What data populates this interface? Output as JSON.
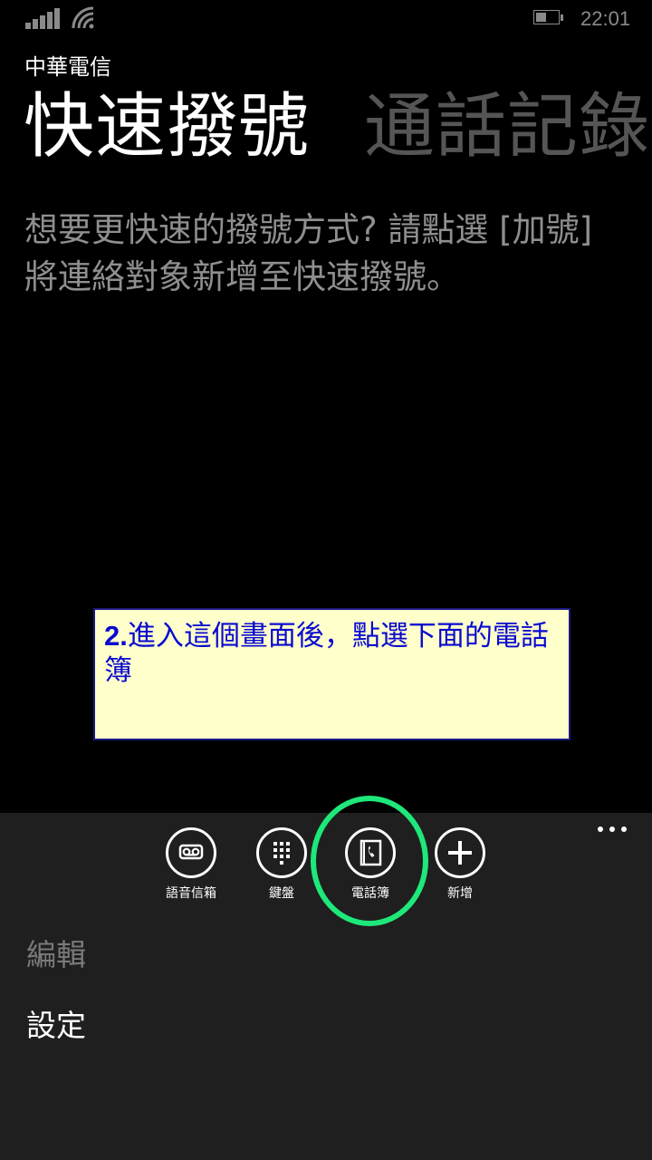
{
  "status_bar": {
    "time": "22:01",
    "icons": [
      "signal-icon",
      "wifi-icon",
      "battery-icon"
    ]
  },
  "header": {
    "carrier": "中華電信"
  },
  "pivot": {
    "tabs": [
      {
        "label": "快速撥號",
        "active": true
      },
      {
        "label": "通話記錄",
        "active": false
      }
    ]
  },
  "main": {
    "hint": "想要更快速的撥號方式? 請點選 [加號] 將連絡對象新增至快速撥號。"
  },
  "annotation": {
    "step": "2.",
    "text": "進入這個畫面後，點選下面的電話簿",
    "background": "#ffffcc",
    "text_color": "#0a0ad0"
  },
  "app_bar": {
    "buttons": [
      {
        "label": "語音信箱",
        "icon": "voicemail-icon"
      },
      {
        "label": "鍵盤",
        "icon": "keypad-icon"
      },
      {
        "label": "電話簿",
        "icon": "phonebook-icon"
      },
      {
        "label": "新增",
        "icon": "add-icon"
      }
    ],
    "menu": [
      {
        "label": "編輯",
        "enabled": false
      },
      {
        "label": "設定",
        "enabled": true
      }
    ],
    "highlight_color": "#1ee87a"
  }
}
